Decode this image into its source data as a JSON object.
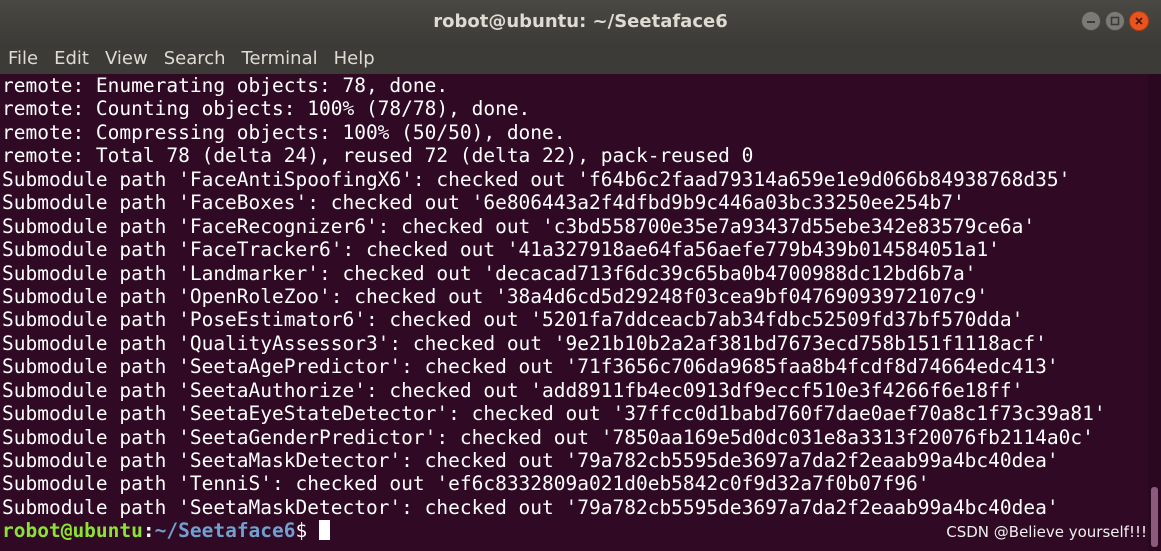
{
  "window": {
    "title": "robot@ubuntu: ~/Seetaface6"
  },
  "menu": [
    "File",
    "Edit",
    "View",
    "Search",
    "Terminal",
    "Help"
  ],
  "terminal": {
    "lines": [
      "remote: Enumerating objects: 78, done.",
      "remote: Counting objects: 100% (78/78), done.",
      "remote: Compressing objects: 100% (50/50), done.",
      "remote: Total 78 (delta 24), reused 72 (delta 22), pack-reused 0",
      "Submodule path 'FaceAntiSpoofingX6': checked out 'f64b6c2faad79314a659e1e9d066b84938768d35'",
      "Submodule path 'FaceBoxes': checked out '6e806443a2f4dfbd9b9c446a03bc33250ee254b7'",
      "Submodule path 'FaceRecognizer6': checked out 'c3bd558700e35e7a93437d55ebe342e83579ce6a'",
      "Submodule path 'FaceTracker6': checked out '41a327918ae64fa56aefe779b439b014584051a1'",
      "Submodule path 'Landmarker': checked out 'decacad713f6dc39c65ba0b4700988dc12bd6b7a'",
      "Submodule path 'OpenRoleZoo': checked out '38a4d6cd5d29248f03cea9bf04769093972107c9'",
      "Submodule path 'PoseEstimator6': checked out '5201fa7ddceacb7ab34fdbc52509fd37bf570dda'",
      "Submodule path 'QualityAssessor3': checked out '9e21b10b2a2af381bd7673ecd758b151f1118acf'",
      "Submodule path 'SeetaAgePredictor': checked out '71f3656c706da9685faa8b4fcdf8d74664edc413'",
      "Submodule path 'SeetaAuthorize': checked out 'add8911fb4ec0913df9eccf510e3f4266f6e18ff'",
      "Submodule path 'SeetaEyeStateDetector': checked out '37ffcc0d1babd760f7dae0aef70a8c1f73c39a81'",
      "Submodule path 'SeetaGenderPredictor': checked out '7850aa169e5d0dc031e8a3313f20076fb2114a0c'",
      "Submodule path 'SeetaMaskDetector': checked out '79a782cb5595de3697a7da2f2eaab99a4bc40dea'",
      "Submodule path 'TenniS': checked out 'ef6c8332809a021d0eb5842c0f9d32a7f0b07f96'",
      "Submodule path 'SeetaMaskDetector': checked out '79a782cb5595de3697a7da2f2eaab99a4bc40dea'"
    ],
    "prompt": {
      "user_host": "robot@ubuntu",
      "separator": ":",
      "path": "~/Seetaface6",
      "symbol": "$"
    }
  },
  "watermark": "CSDN @Believe yourself!!!",
  "colors": {
    "terminal_bg": "#300a24",
    "titlebar_bg": "#3c3b37",
    "prompt_user": "#8ae234",
    "prompt_path": "#729fcf",
    "close_button": "#e9541f"
  },
  "icons": [
    "minimize-icon",
    "maximize-icon",
    "close-icon"
  ]
}
